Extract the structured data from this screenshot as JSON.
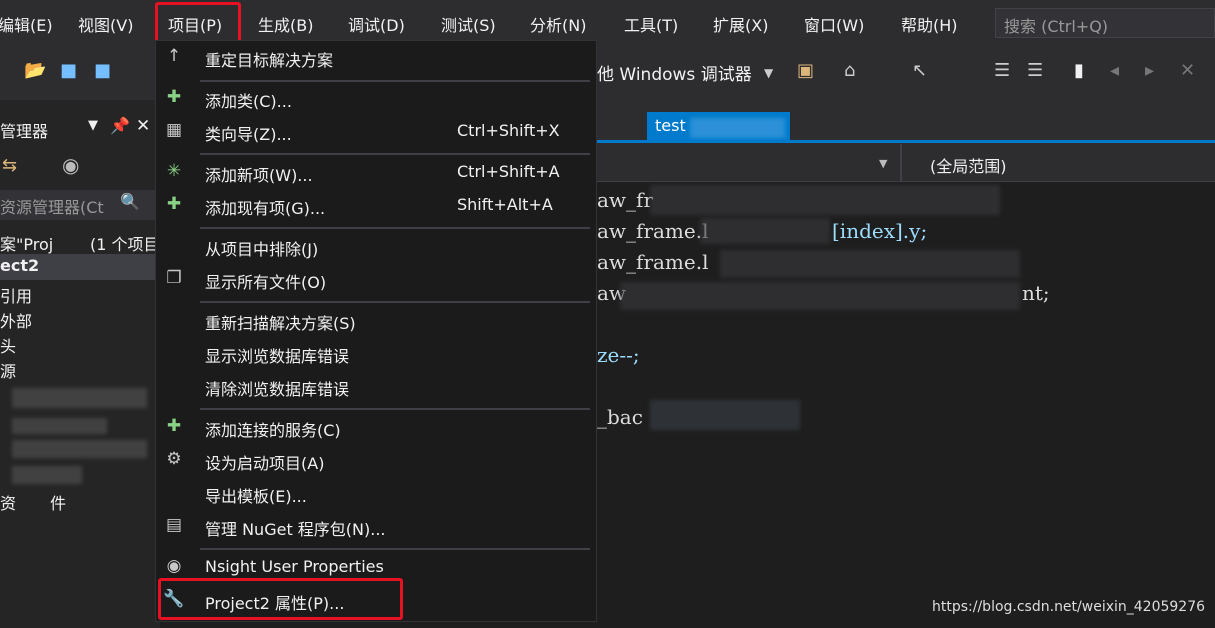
{
  "menubar": {
    "items": [
      "编辑(E)",
      "视图(V)",
      "项目(P)",
      "生成(B)",
      "调试(D)",
      "测试(S)",
      "分析(N)",
      "工具(T)",
      "扩展(X)",
      "窗口(W)",
      "帮助(H)"
    ],
    "search_placeholder": "搜索 (Ctrl+Q)"
  },
  "toolbar": {
    "debugger": "他 Windows 调试器"
  },
  "solution_explorer": {
    "title": "管理器",
    "search_placeholder": "资源管理器(Ct",
    "tree": [
      "案\"Proj",
      "(1 个项目",
      "ect2",
      "引用",
      "外部",
      "头",
      "源",
      "资",
      "件"
    ]
  },
  "editor": {
    "tab": "test",
    "scope": "(全局范围)",
    "code_lines": [
      "aw_fr",
      "aw_frame.l",
      "[index].y;",
      "aw_frame.l",
      "aw",
      "nt;",
      "ze--;",
      "_bac"
    ]
  },
  "project_menu": {
    "items": [
      {
        "icon": "arrow-up-icon",
        "label": "重定目标解决方案",
        "shortcut": ""
      },
      {
        "icon": "add-class-icon",
        "label": "添加类(C)...",
        "shortcut": ""
      },
      {
        "icon": "class-wizard-icon",
        "label": "类向导(Z)...",
        "shortcut": "Ctrl+Shift+X"
      },
      {
        "icon": "add-new-item-icon",
        "label": "添加新项(W)...",
        "shortcut": "Ctrl+Shift+A"
      },
      {
        "icon": "add-existing-item-icon",
        "label": "添加现有项(G)...",
        "shortcut": "Shift+Alt+A"
      },
      {
        "icon": "",
        "label": "从项目中排除(J)",
        "shortcut": ""
      },
      {
        "icon": "show-all-files-icon",
        "label": "显示所有文件(O)",
        "shortcut": ""
      },
      {
        "icon": "",
        "label": "重新扫描解决方案(S)",
        "shortcut": ""
      },
      {
        "icon": "",
        "label": "显示浏览数据库错误",
        "shortcut": ""
      },
      {
        "icon": "",
        "label": "清除浏览数据库错误",
        "shortcut": ""
      },
      {
        "icon": "connected-service-icon",
        "label": "添加连接的服务(C)",
        "shortcut": ""
      },
      {
        "icon": "gear-icon",
        "label": "设为启动项目(A)",
        "shortcut": ""
      },
      {
        "icon": "",
        "label": "导出模板(E)...",
        "shortcut": ""
      },
      {
        "icon": "nuget-package-icon",
        "label": "管理 NuGet 程序包(N)...",
        "shortcut": ""
      },
      {
        "icon": "nsight-icon",
        "label": "Nsight User Properties",
        "shortcut": ""
      },
      {
        "icon": "wrench-icon",
        "label": "Project2 属性(P)...",
        "shortcut": ""
      }
    ]
  },
  "watermark": "https://blog.csdn.net/weixin_42059276",
  "colors": {
    "highlight": "#e81123",
    "accent": "#007acc"
  }
}
